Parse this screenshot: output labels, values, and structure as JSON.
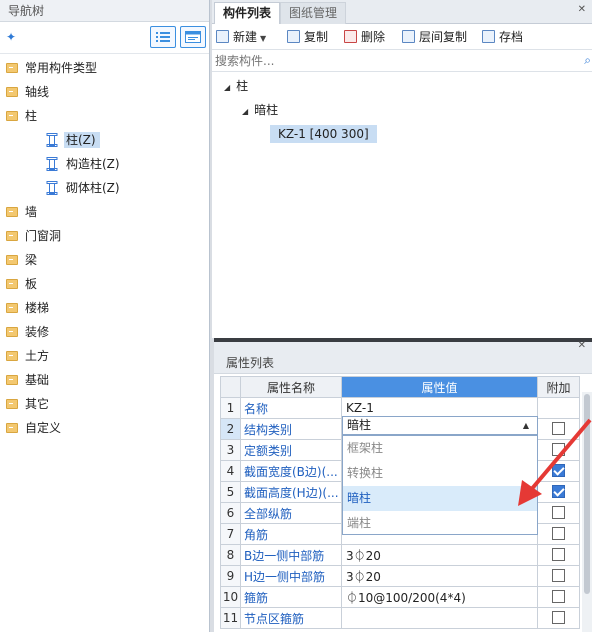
{
  "nav": {
    "title": "导航树",
    "add_icon": "plus-sparkle-icon",
    "folders": [
      {
        "label": "常用构件类型"
      },
      {
        "label": "轴线"
      },
      {
        "label": "柱"
      },
      {
        "label": "墙"
      },
      {
        "label": "门窗洞"
      },
      {
        "label": "梁"
      },
      {
        "label": "板"
      },
      {
        "label": "楼梯"
      },
      {
        "label": "装修"
      },
      {
        "label": "土方"
      },
      {
        "label": "基础"
      },
      {
        "label": "其它"
      },
      {
        "label": "自定义"
      }
    ],
    "column_children": [
      {
        "label": "柱(Z)",
        "selected": true
      },
      {
        "label": "构造柱(Z)",
        "selected": false
      },
      {
        "label": "砌体柱(Z)",
        "selected": false
      }
    ]
  },
  "tabs": {
    "active": "构件列表",
    "inactive": "图纸管理"
  },
  "toolbar": {
    "new": "新建",
    "copy": "复制",
    "delete": "删除",
    "floor_copy": "层间复制",
    "save": "存档"
  },
  "search": {
    "placeholder": "搜索构件..."
  },
  "component_tree": {
    "root": "柱",
    "group": "暗柱",
    "item": "KZ-1 [400 300]"
  },
  "properties": {
    "title": "属性列表",
    "headers": {
      "name": "属性名称",
      "value": "属性值",
      "add": "附加"
    },
    "rows": [
      {
        "num": "1",
        "name": "名称",
        "value": "KZ-1",
        "checkbox": false,
        "checked": false
      },
      {
        "num": "2",
        "name": "结构类别",
        "value": "",
        "checkbox": true,
        "checked": false
      },
      {
        "num": "3",
        "name": "定额类别",
        "value": "",
        "checkbox": true,
        "checked": false
      },
      {
        "num": "4",
        "name": "截面宽度(B边)(...",
        "value": "",
        "checkbox": true,
        "checked": true
      },
      {
        "num": "5",
        "name": "截面高度(H边)(...",
        "value": "",
        "checkbox": true,
        "checked": true
      },
      {
        "num": "6",
        "name": "全部纵筋",
        "value": "",
        "checkbox": true,
        "checked": false
      },
      {
        "num": "7",
        "name": "角筋",
        "value": "",
        "checkbox": true,
        "checked": false
      },
      {
        "num": "8",
        "name": "B边一侧中部筋",
        "value": "3⏀20",
        "checkbox": true,
        "checked": false
      },
      {
        "num": "9",
        "name": "H边一侧中部筋",
        "value": "3⏀20",
        "checkbox": true,
        "checked": false
      },
      {
        "num": "10",
        "name": "箍筋",
        "value": "⏀10@100/200(4*4)",
        "checkbox": true,
        "checked": false
      },
      {
        "num": "11",
        "name": "节点区箍筋",
        "value": "",
        "checkbox": true,
        "checked": false
      }
    ],
    "select_value": "暗柱",
    "dropdown_options": [
      {
        "label": "框架柱",
        "selected": false
      },
      {
        "label": "转换柱",
        "selected": false
      },
      {
        "label": "暗柱",
        "selected": true
      },
      {
        "label": "端柱",
        "selected": false
      }
    ]
  },
  "colors": {
    "accent": "#4a90e2",
    "annotation_arrow": "#e53935"
  }
}
